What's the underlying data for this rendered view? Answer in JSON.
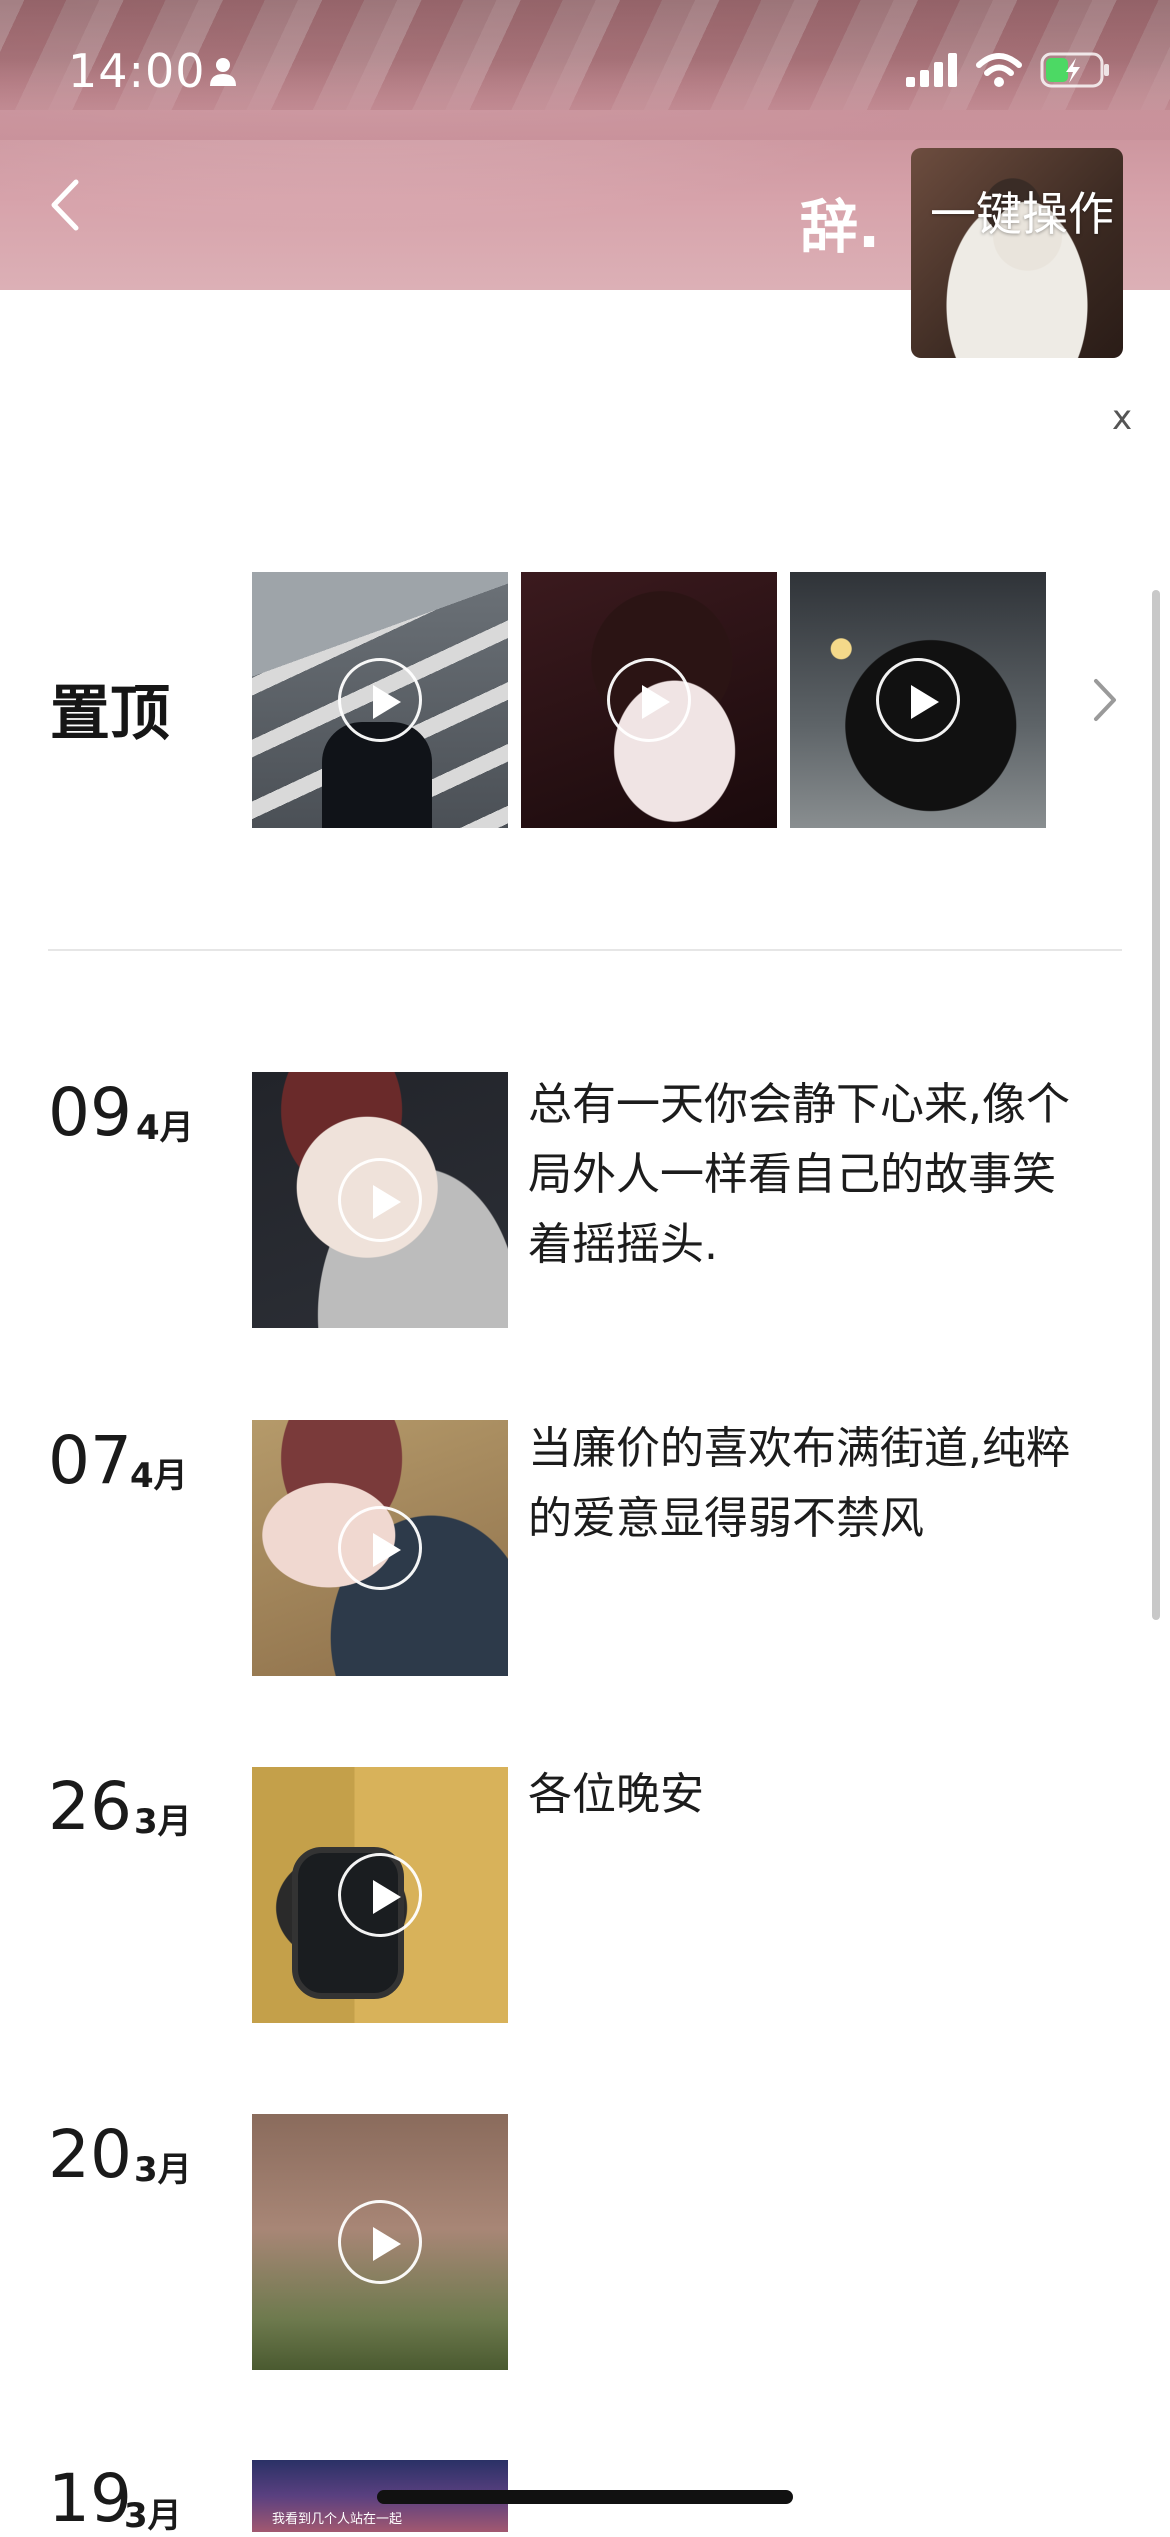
{
  "status_bar": {
    "time": "14:00"
  },
  "header": {
    "title": "辞.",
    "batch_action": "一键操作",
    "close": "x"
  },
  "pinned": {
    "label": "置顶",
    "videos": [
      {
        "name": "pinned-video-1"
      },
      {
        "name": "pinned-video-2"
      },
      {
        "name": "pinned-video-3"
      }
    ]
  },
  "timeline": [
    {
      "day": "09",
      "month": "4月",
      "text": "总有一天你会静下心来,像个局外人一样看自己的故事笑着摇摇头."
    },
    {
      "day": "07",
      "month": "4月",
      "text": "当廉价的喜欢布满街道,纯粹的爱意显得弱不禁风"
    },
    {
      "day": "26",
      "month": "3月",
      "text": "各位晚安"
    },
    {
      "day": "20",
      "month": "3月",
      "text": ""
    },
    {
      "day": "19",
      "month": "3月",
      "text": ""
    }
  ],
  "thumbnail_caption_partial": "我看到几个人站在一起"
}
